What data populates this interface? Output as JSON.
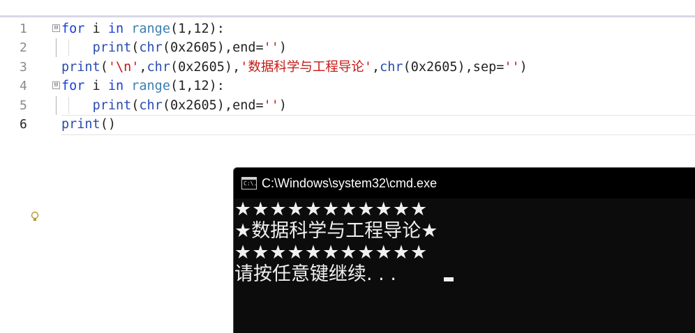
{
  "editor": {
    "line_numbers": [
      "1",
      "2",
      "3",
      "4",
      "5",
      "6"
    ],
    "lines": [
      [
        [
          "kw",
          "for"
        ],
        [
          "plain",
          " i "
        ],
        [
          "kw",
          "in"
        ],
        [
          "plain",
          " "
        ],
        [
          "fn",
          "range"
        ],
        [
          "plain",
          "(1,12):"
        ]
      ],
      [
        [
          "plain",
          "    "
        ],
        [
          "bi",
          "print"
        ],
        [
          "plain",
          "("
        ],
        [
          "bi",
          "chr"
        ],
        [
          "plain",
          "(0x2605),end="
        ],
        [
          "str",
          "''"
        ],
        [
          "plain",
          ")"
        ]
      ],
      [
        [
          "bi",
          "print"
        ],
        [
          "plain",
          "("
        ],
        [
          "str",
          "'\\n'"
        ],
        [
          "plain",
          ","
        ],
        [
          "bi",
          "chr"
        ],
        [
          "plain",
          "(0x2605),"
        ],
        [
          "str",
          "'数据科学与工程导论'"
        ],
        [
          "plain",
          ","
        ],
        [
          "bi",
          "chr"
        ],
        [
          "plain",
          "(0x2605),sep="
        ],
        [
          "str",
          "''"
        ],
        [
          "plain",
          ")"
        ]
      ],
      [
        [
          "kw",
          "for"
        ],
        [
          "plain",
          " i "
        ],
        [
          "kw",
          "in"
        ],
        [
          "plain",
          " "
        ],
        [
          "fn",
          "range"
        ],
        [
          "plain",
          "(1,12):"
        ]
      ],
      [
        [
          "plain",
          "    "
        ],
        [
          "bi",
          "print"
        ],
        [
          "plain",
          "("
        ],
        [
          "bi",
          "chr"
        ],
        [
          "plain",
          "(0x2605),end="
        ],
        [
          "str",
          "''"
        ],
        [
          "plain",
          ")"
        ]
      ],
      [
        [
          "bi",
          "print"
        ],
        [
          "plain",
          "()"
        ]
      ]
    ],
    "fold_marker": "⊟",
    "bulb_icon": "lightbulb-icon"
  },
  "console": {
    "title": "C:\\Windows\\system32\\cmd.exe",
    "icon_label": "C:\\.",
    "output_lines": [
      "★★★★★★★★★★★",
      "★数据科学与工程导论★",
      "★★★★★★★★★★★",
      "请按任意键继续. . ."
    ]
  },
  "colors": {
    "keyword": "#1a3fd6",
    "string": "#c41a16",
    "console_bg": "#0c0c0c",
    "console_text": "#f0f0f0"
  }
}
